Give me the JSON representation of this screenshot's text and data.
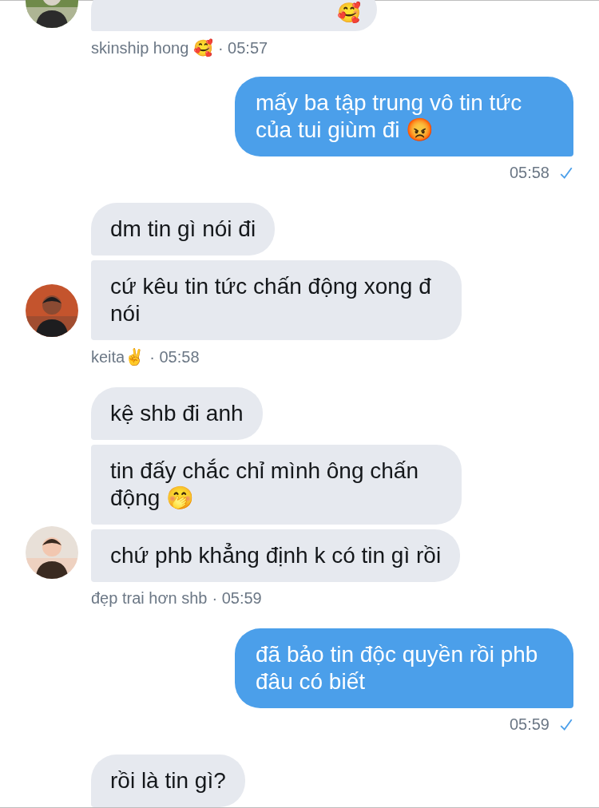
{
  "messages": [
    {
      "kind": "received",
      "avatar": {
        "kind": "picture"
      },
      "bubbles": [
        {
          "text": "🥰"
        }
      ],
      "meta": {
        "name": "skinship hong 🥰",
        "time": "· 05:57"
      }
    },
    {
      "kind": "sent",
      "bubbles": [
        {
          "text": "mấy ba tập trung vô tin tức của tui giùm đi 😡"
        }
      ],
      "meta": {
        "time": "05:58",
        "read": true
      }
    },
    {
      "kind": "received",
      "avatar": {
        "kind": "picture"
      },
      "bubbles": [
        {
          "text": "dm tin gì nói đi"
        },
        {
          "text": "cứ kêu tin tức chấn động xong đ nói"
        }
      ],
      "meta": {
        "name": "keita✌️",
        "time": "· 05:58"
      }
    },
    {
      "kind": "received",
      "avatar": {
        "kind": "picture"
      },
      "bubbles": [
        {
          "text": "kệ shb đi anh"
        },
        {
          "text": "tin đấy chắc chỉ mình ông chấn động 🤭"
        },
        {
          "text": "chứ phb khẳng định k có tin gì rồi"
        }
      ],
      "meta": {
        "name": "đẹp trai hơn shb",
        "time": "· 05:59"
      }
    },
    {
      "kind": "sent",
      "bubbles": [
        {
          "text": "đã bảo tin độc quyền rồi phb đâu có biết"
        }
      ],
      "meta": {
        "time": "05:59",
        "read": true
      }
    },
    {
      "kind": "received",
      "bubbles": [
        {
          "text": "rồi là tin gì?"
        }
      ]
    }
  ]
}
